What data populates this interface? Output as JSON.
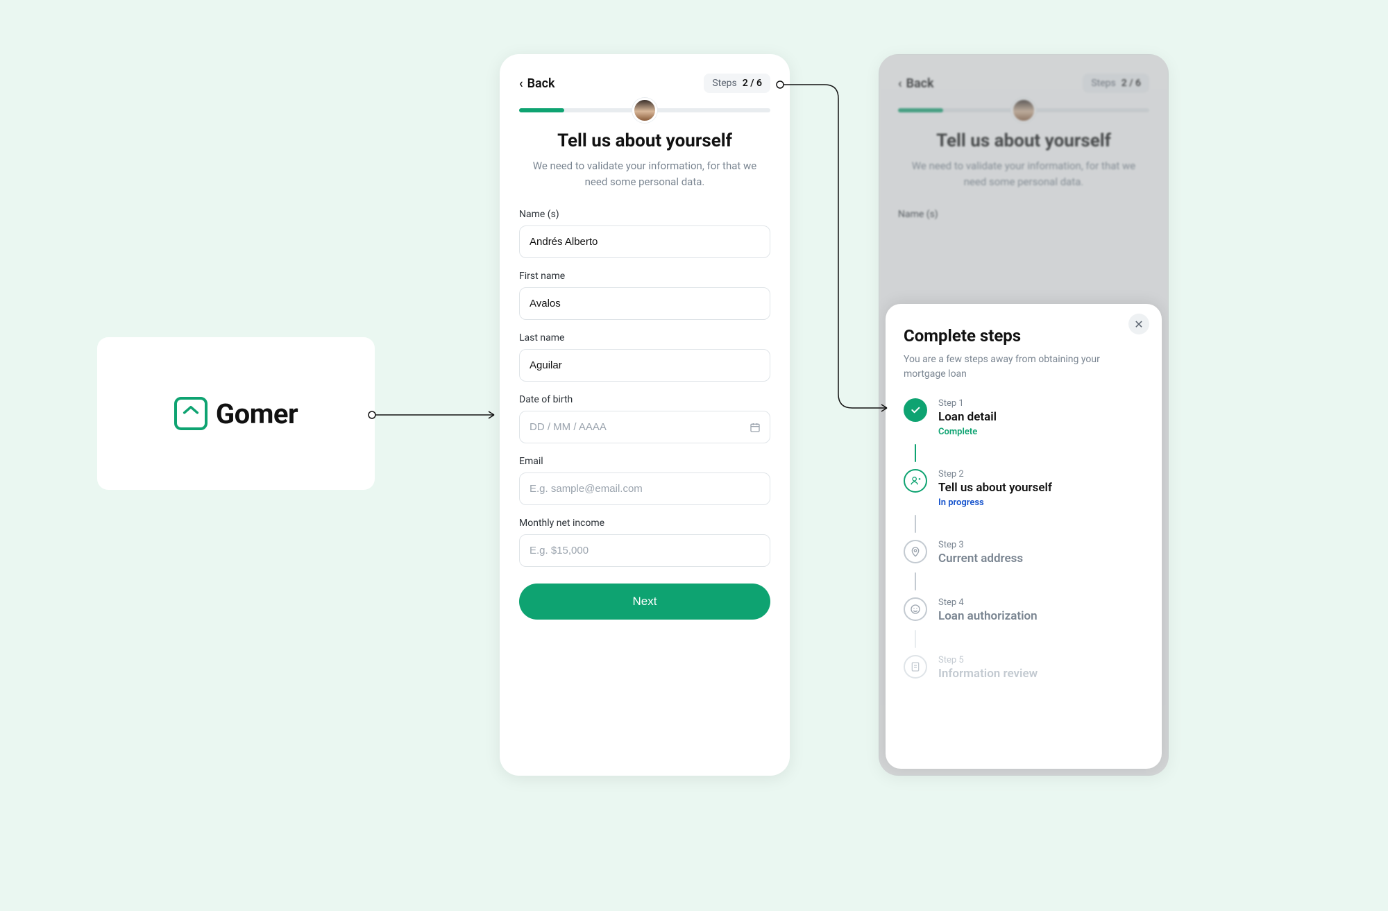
{
  "brand": {
    "name": "Gomer"
  },
  "form": {
    "back_label": "Back",
    "steps_label": "Steps",
    "steps_count": "2 / 6",
    "title": "Tell us about yourself",
    "subtitle": "We need to validate your information, for that we need some personal data.",
    "fields": {
      "names": {
        "label": "Name (s)",
        "value": "Andrés Alberto"
      },
      "first": {
        "label": "First name",
        "value": "Avalos"
      },
      "last": {
        "label": "Last name",
        "value": "Aguilar"
      },
      "dob": {
        "label": "Date of birth",
        "placeholder": "DD / MM / AAAA"
      },
      "email": {
        "label": "Email",
        "placeholder": "E.g. sample@email.com"
      },
      "income": {
        "label": "Monthly net income",
        "placeholder": "E.g. $15,000"
      }
    },
    "next_label": "Next"
  },
  "sheet": {
    "title": "Complete steps",
    "subtitle": "You are a few steps away from obtaining your mortgage loan",
    "steps": [
      {
        "kicker": "Step 1",
        "name": "Loan detail",
        "status": "Complete",
        "state": "done"
      },
      {
        "kicker": "Step 2",
        "name": "Tell us about yourself",
        "status": "In progress",
        "state": "active"
      },
      {
        "kicker": "Step 3",
        "name": "Current address",
        "status": "",
        "state": "pending"
      },
      {
        "kicker": "Step 4",
        "name": "Loan authorization",
        "status": "",
        "state": "pending"
      },
      {
        "kicker": "Step 5",
        "name": "Information review",
        "status": "",
        "state": "faded"
      }
    ]
  }
}
